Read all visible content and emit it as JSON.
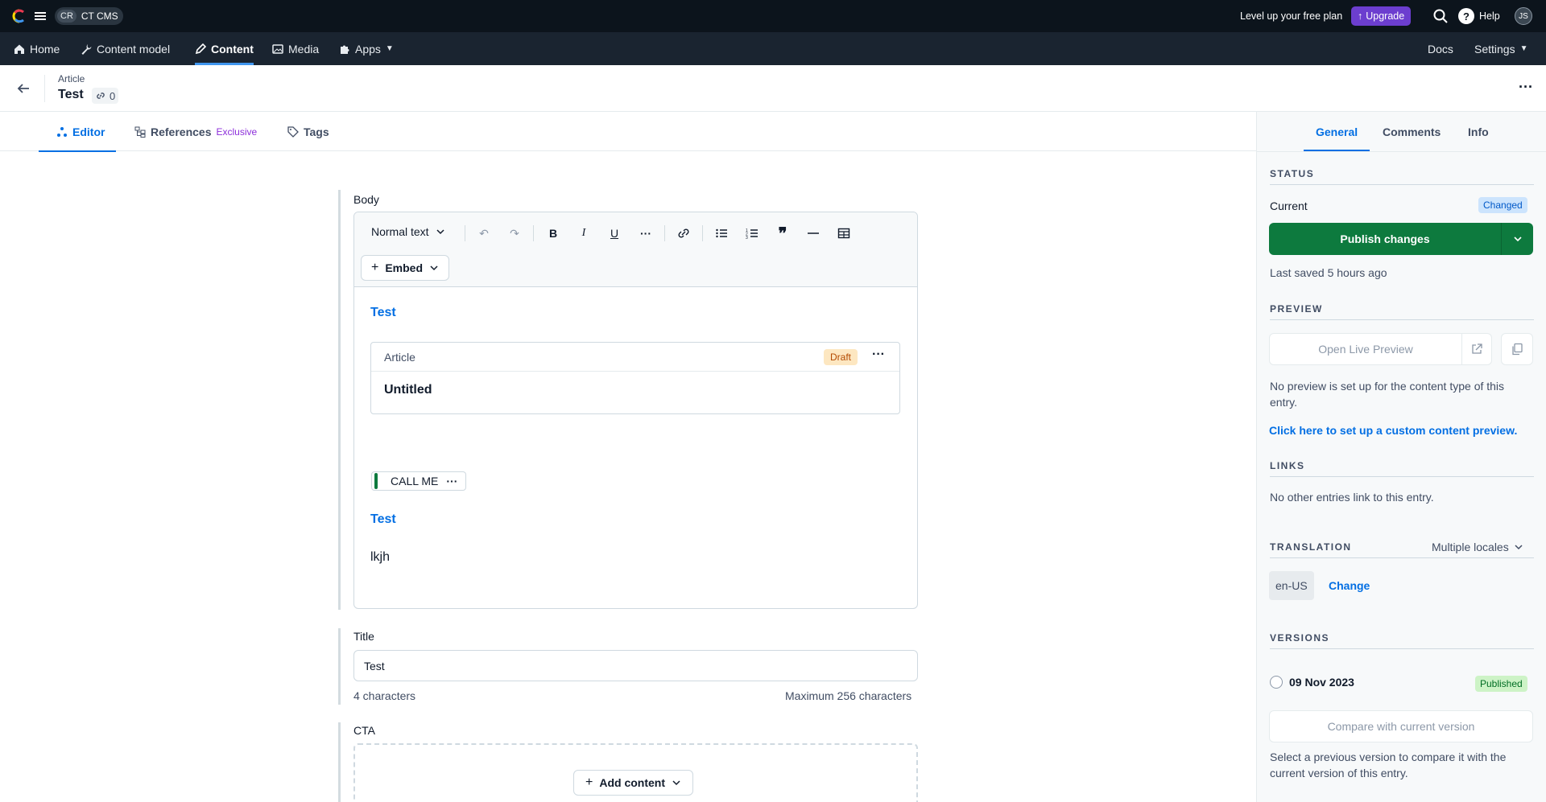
{
  "topbar": {
    "space_abbr": "CR",
    "space_name": "CT CMS",
    "upsell_text": "Level up your free plan",
    "upgrade_label": "Upgrade",
    "help_label": "Help",
    "avatar_initials": "JS"
  },
  "nav": {
    "home": "Home",
    "content_model": "Content model",
    "content": "Content",
    "media": "Media",
    "apps": "Apps",
    "docs": "Docs",
    "settings": "Settings"
  },
  "entry": {
    "content_type": "Article",
    "title": "Test",
    "links_count": "0"
  },
  "editor_tabs": {
    "editor": "Editor",
    "references": "References",
    "references_badge": "Exclusive",
    "tags": "Tags"
  },
  "body_field": {
    "label": "Body",
    "text_style": "Normal text",
    "embed_label": "Embed",
    "heading_link_1": "Test",
    "embedded_entry": {
      "content_type": "Article",
      "status": "Draft",
      "title": "Untitled"
    },
    "inline_entry_label": "CALL ME",
    "heading_link_2": "Test",
    "paragraph": "lkjh"
  },
  "title_field": {
    "label": "Title",
    "value": "Test",
    "char_count": "4 characters",
    "max_chars": "Maximum 256 characters"
  },
  "cta_field": {
    "label": "CTA",
    "add_content_label": "Add content"
  },
  "sidebar": {
    "tabs": {
      "general": "General",
      "comments": "Comments",
      "info": "Info"
    },
    "status": {
      "heading": "STATUS",
      "current_label": "Current",
      "badge": "Changed",
      "publish_label": "Publish changes",
      "last_saved": "Last saved 5 hours ago"
    },
    "preview": {
      "heading": "PREVIEW",
      "open_label": "Open Live Preview",
      "note": "No preview is set up for the content type of this entry.",
      "setup_link": "Click here to set up a custom content preview."
    },
    "links": {
      "heading": "LINKS",
      "note": "No other entries link to this entry."
    },
    "translation": {
      "heading": "TRANSLATION",
      "mode": "Multiple locales",
      "locale": "en-US",
      "change_label": "Change"
    },
    "versions": {
      "heading": "VERSIONS",
      "date": "09 Nov 2023",
      "badge": "Published",
      "compare_label": "Compare with current version",
      "note": "Select a previous version to compare it with the current version of this entry."
    }
  },
  "colors": {
    "accent": "#036fe3",
    "publish_green": "#0d7a3e",
    "upgrade_purple": "#6c3ecf",
    "topbar_bg": "#0c141c"
  }
}
